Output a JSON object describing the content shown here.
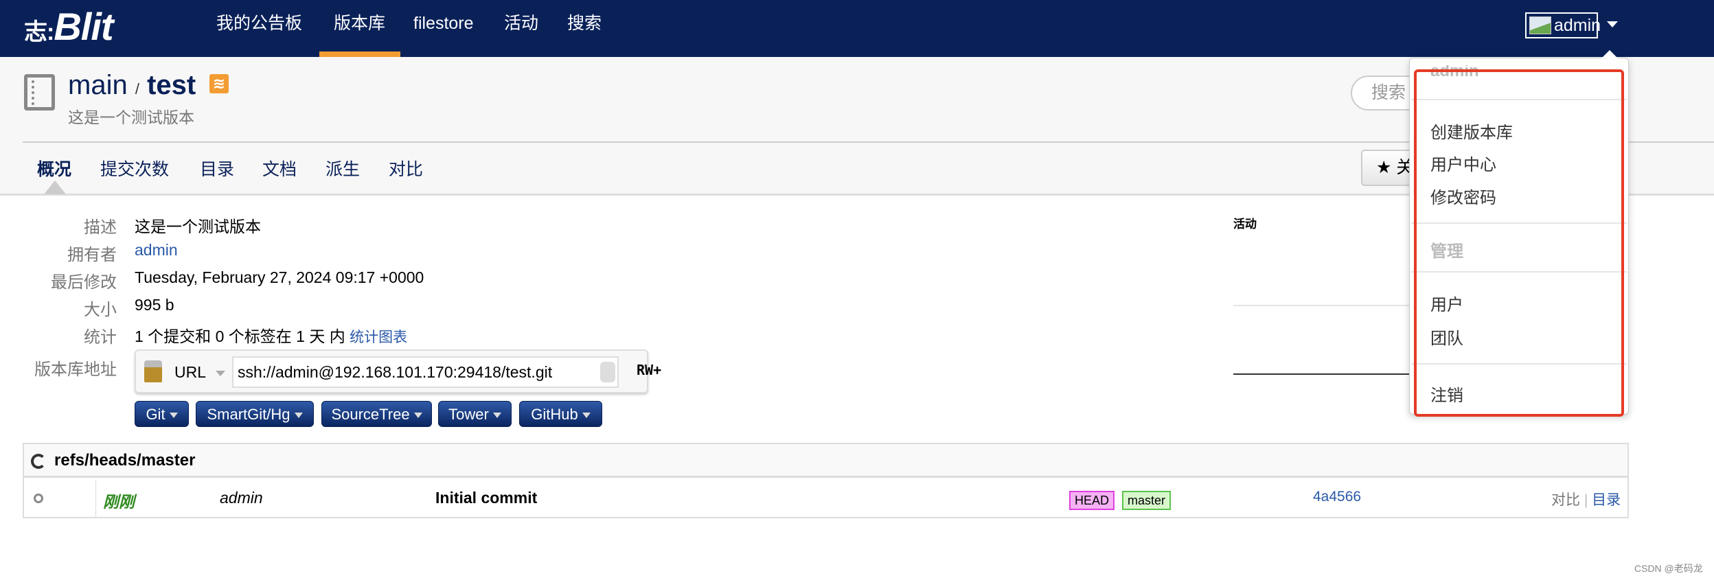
{
  "navbar": {
    "logo": "Blit",
    "logo_prefix": "志:",
    "items": [
      "我的公告板",
      "版本库",
      "filestore",
      "活动",
      "搜索"
    ],
    "active": "版本库",
    "user": "admin"
  },
  "repo": {
    "project": "main",
    "separator": "/",
    "name": "test",
    "description": "这是一个测试版本"
  },
  "tabs": [
    "概况",
    "提交次数",
    "目录",
    "文档",
    "派生",
    "对比"
  ],
  "search_placeholder": "搜索",
  "star_label": "★ 关",
  "summary": {
    "labels": [
      "描述",
      "拥有者",
      "最后修改",
      "大小",
      "统计",
      "版本库地址"
    ],
    "description": "这是一个测试版本",
    "owner": "admin",
    "last_modified": "Tuesday, February 27, 2024 09:17 +0000",
    "size": "995 b",
    "stats": "1 个提交和 0 个标签在 1 天 内",
    "stats_link": "统计图表",
    "url_protocol": "URL",
    "url": "ssh://admin@192.168.101.170:29418/test.git",
    "permission": "RW+"
  },
  "clone_buttons": [
    "Git",
    "SmartGit/Hg",
    "SourceTree",
    "Tower",
    "GitHub"
  ],
  "activity_title": "活动",
  "log": {
    "branch": "refs/heads/master",
    "rows": [
      {
        "time": "刚刚",
        "author": "admin",
        "message": "Initial commit",
        "refs": [
          "HEAD",
          "master"
        ],
        "commit": "4a4566",
        "links": [
          "对比",
          "目录"
        ]
      }
    ]
  },
  "user_menu": {
    "header": "admin",
    "items": [
      "创建版本库",
      "用户中心",
      "修改密码"
    ],
    "admin_header": "管理",
    "admin_items": [
      "用户",
      "团队"
    ],
    "logout": "注销"
  },
  "colors": {
    "navbar": "#0a2158",
    "accent": "#f39c32",
    "highlight": "#e53a26"
  },
  "watermark": "CSDN @老码龙"
}
